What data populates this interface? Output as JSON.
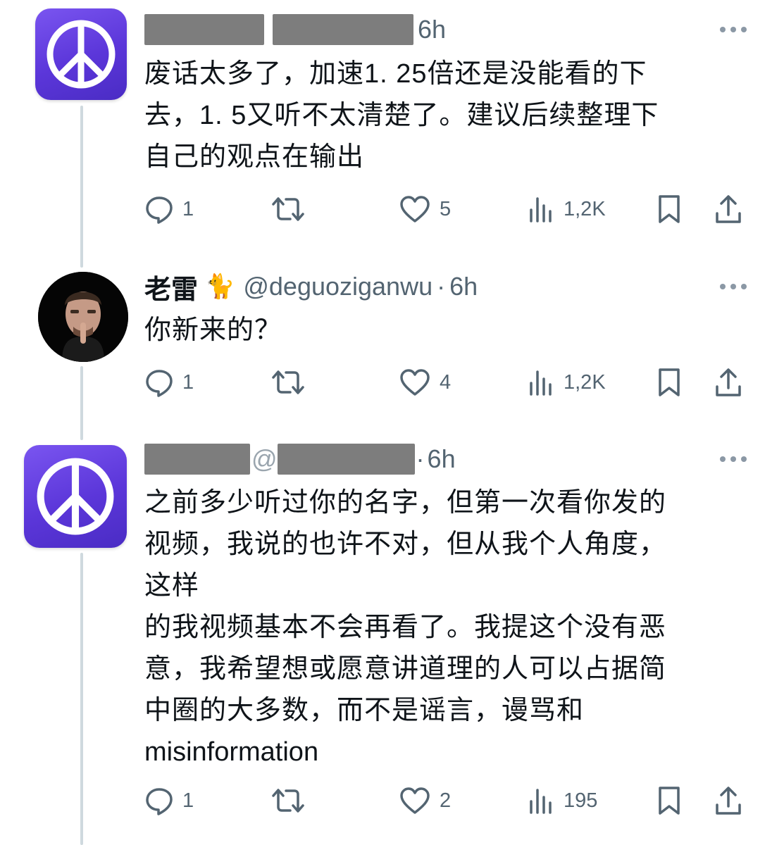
{
  "tweets": [
    {
      "timestamp": "6h",
      "lines": [
        "废话太多了，加速1. 25倍还是没能看的下",
        "去，1. 5又听不太清楚了。建议后续整理下",
        "自己的观点在输出"
      ],
      "replies": "1",
      "retweets": "",
      "likes": "5",
      "views": "1,2K"
    },
    {
      "name": "老雷",
      "emoji": "🐈",
      "handle": "@deguoziganwu",
      "separator": "·",
      "timestamp": "6h",
      "lines": [
        "你新来的？"
      ],
      "replies": "1",
      "retweets": "",
      "likes": "4",
      "views": "1,2K"
    },
    {
      "handle_prefix": "@",
      "separator": "·",
      "timestamp": "6h",
      "lines": [
        "之前多少听过你的名字，但第一次看你发的",
        "视频，我说的也许不对，但从我个人角度，",
        "这样",
        "的我视频基本不会再看了。我提这个没有恶",
        "意，我希望想或愿意讲道理的人可以占据简",
        "中圈的大多数，而不是谣言，谩骂和",
        "misinformation"
      ],
      "replies": "1",
      "retweets": "",
      "likes": "2",
      "views": "195"
    }
  ],
  "icons": {
    "avatar_default": "peace-sign-icon",
    "more": "more-horizontal-icon",
    "reply": "reply-bubble-icon",
    "retweet": "retweet-icon",
    "like": "heart-icon",
    "views": "bar-chart-icon",
    "bookmark": "bookmark-icon",
    "share": "share-upload-icon"
  },
  "colors": {
    "avatar_purple": "#5b36d9",
    "thread_line": "#cfd9de",
    "secondary_text": "#536471",
    "primary_text": "#0f1419",
    "redaction": "#7d7d7d"
  }
}
